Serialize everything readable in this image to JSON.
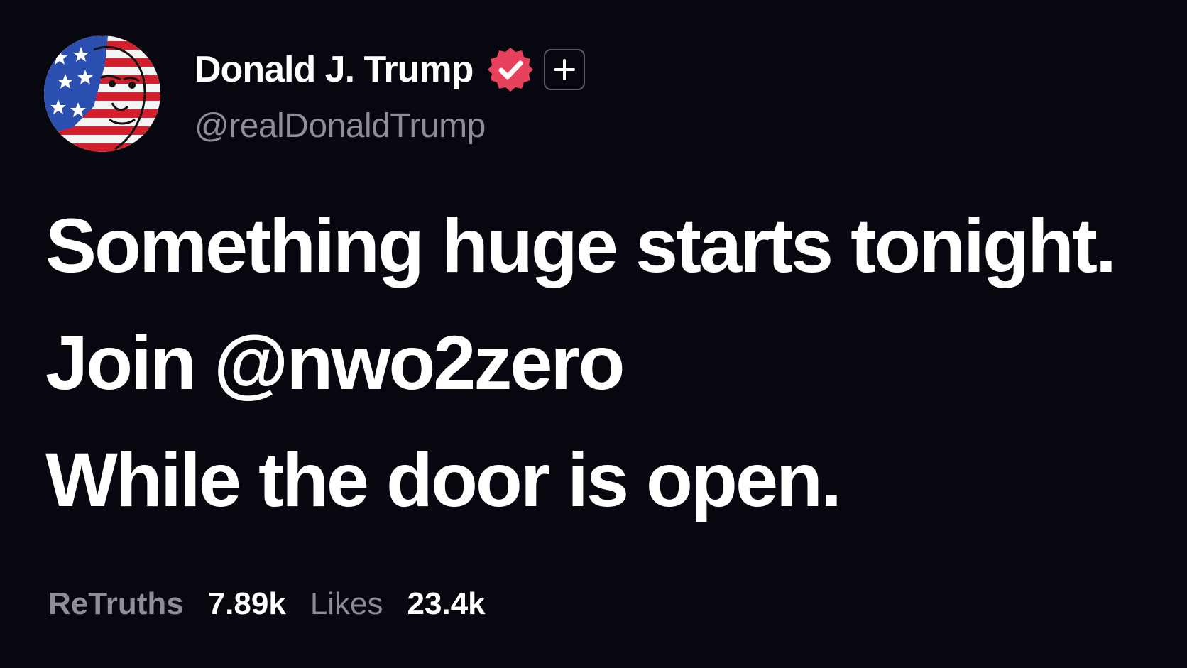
{
  "author": {
    "display_name": "Donald J. Trump",
    "handle": "@realDonaldTrump",
    "verified_badge_color": "#e8415d",
    "avatar_icon": "avatar-flag-portrait",
    "follow_icon": "plus-icon"
  },
  "post": {
    "line1": "Something huge starts tonight.",
    "line2_prefix": "Join ",
    "line2_mention": "@nwo2zero",
    "line3": "While the door is open."
  },
  "stats": {
    "retruths_label": "ReTruths",
    "retruths_value": "7.89k",
    "likes_label": "Likes",
    "likes_value": "23.4k"
  },
  "colors": {
    "background": "#07070f",
    "text": "#ffffff",
    "muted": "#8e8e9a"
  }
}
